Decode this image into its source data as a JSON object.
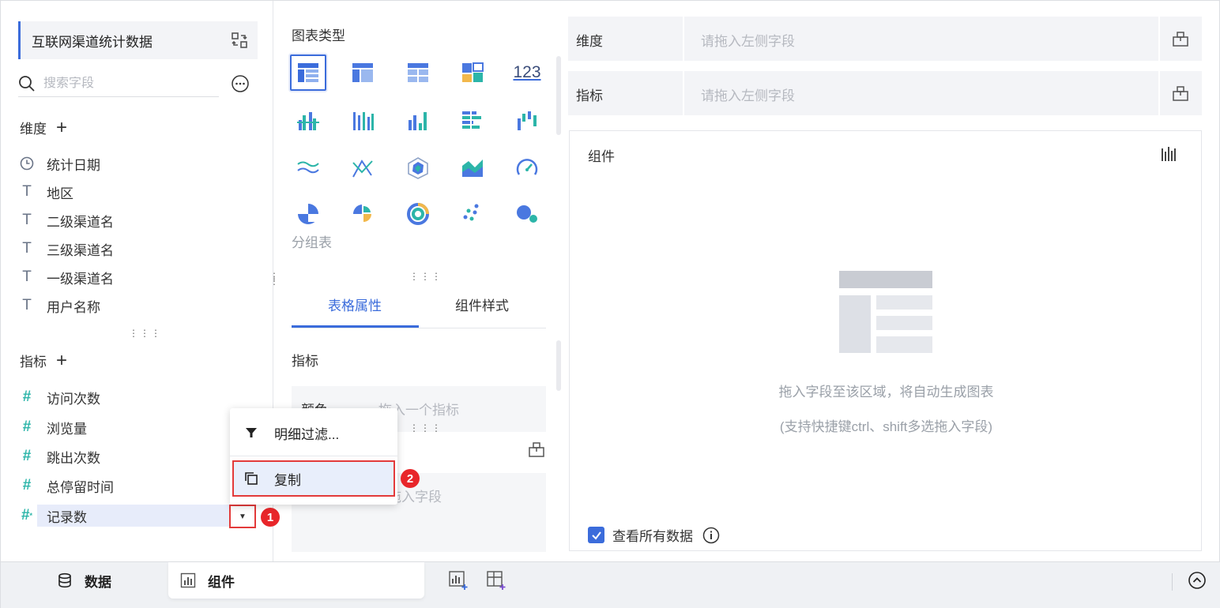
{
  "left": {
    "dataset_name": "互联网渠道统计数据",
    "search_placeholder": "搜索字段",
    "dimension_header": "维度",
    "dimensions": [
      {
        "label": "统计日期",
        "icon": "clock-icon"
      },
      {
        "label": "地区",
        "icon": "text-type-icon"
      },
      {
        "label": "二级渠道名",
        "icon": "text-type-icon"
      },
      {
        "label": "三级渠道名",
        "icon": "text-type-icon"
      },
      {
        "label": "一级渠道名",
        "icon": "text-type-icon"
      },
      {
        "label": "用户名称",
        "icon": "text-type-icon"
      }
    ],
    "measure_header": "指标",
    "measures": [
      {
        "label": "访问次数",
        "icon": "number-type-icon"
      },
      {
        "label": "浏览量",
        "icon": "number-type-icon"
      },
      {
        "label": "跳出次数",
        "icon": "number-type-icon"
      },
      {
        "label": "总停留时间",
        "icon": "number-type-icon"
      },
      {
        "label": "记录数",
        "icon": "record-count-icon"
      }
    ]
  },
  "context_menu": {
    "items": [
      {
        "label": "明细过滤...",
        "icon": "filter-icon"
      },
      {
        "label": "复制",
        "icon": "copy-icon"
      }
    ]
  },
  "annotations": {
    "badge1": "1",
    "badge2": "2"
  },
  "middle": {
    "chart_type_title": "图表类型",
    "number_chart_label": "123",
    "selected_chart_name": "分组表",
    "tabs": [
      {
        "label": "表格属性",
        "active": true
      },
      {
        "label": "组件样式",
        "active": false
      }
    ],
    "property_title": "指标",
    "color_label": "颜色",
    "color_placeholder": "拖入一个指标",
    "field_placeholder": "拖入字段"
  },
  "right": {
    "dimension_shelf_label": "维度",
    "dimension_shelf_placeholder": "请拖入左侧字段",
    "measure_shelf_label": "指标",
    "measure_shelf_placeholder": "请拖入左侧字段",
    "canvas_title": "组件",
    "empty_hint": "拖入字段至该区域，将自动生成图表",
    "empty_sub_hint": "(支持快捷键ctrl、shift多选拖入字段)",
    "view_all_label": "查看所有数据",
    "view_all_checked": true
  },
  "bottom": {
    "data_tab": "数据",
    "component_tab": "组件"
  },
  "colors": {
    "accent": "#3b6cdb",
    "measure": "#2cb5a9",
    "highlight_border": "#e33a3a",
    "badge": "#e8262a"
  }
}
